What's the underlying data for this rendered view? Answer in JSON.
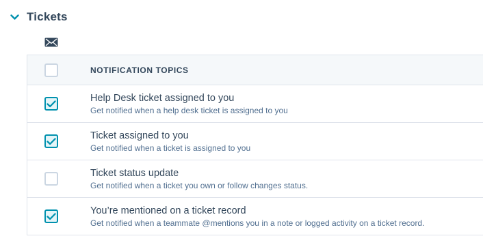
{
  "section": {
    "title": "Tickets",
    "expanded": true
  },
  "channel_icon": "envelope-icon",
  "table": {
    "header_label": "NOTIFICATION TOPICS",
    "header_checked": false,
    "rows": [
      {
        "title": "Help Desk ticket assigned to you",
        "description": "Get notified when a help desk ticket is assigned to you",
        "checked": true
      },
      {
        "title": "Ticket assigned to you",
        "description": "Get notified when a ticket is assigned to you",
        "checked": true
      },
      {
        "title": "Ticket status update",
        "description": "Get notified when a ticket you own or follow changes status.",
        "checked": false
      },
      {
        "title": "You’re mentioned on a ticket record",
        "description": "Get notified when a teammate @mentions you in a note or logged activity on a ticket record.",
        "checked": true
      }
    ]
  },
  "colors": {
    "text": "#33475b",
    "accent": "#0091ae",
    "border": "#dfe3eb",
    "header_bg": "#f5f8fa"
  }
}
